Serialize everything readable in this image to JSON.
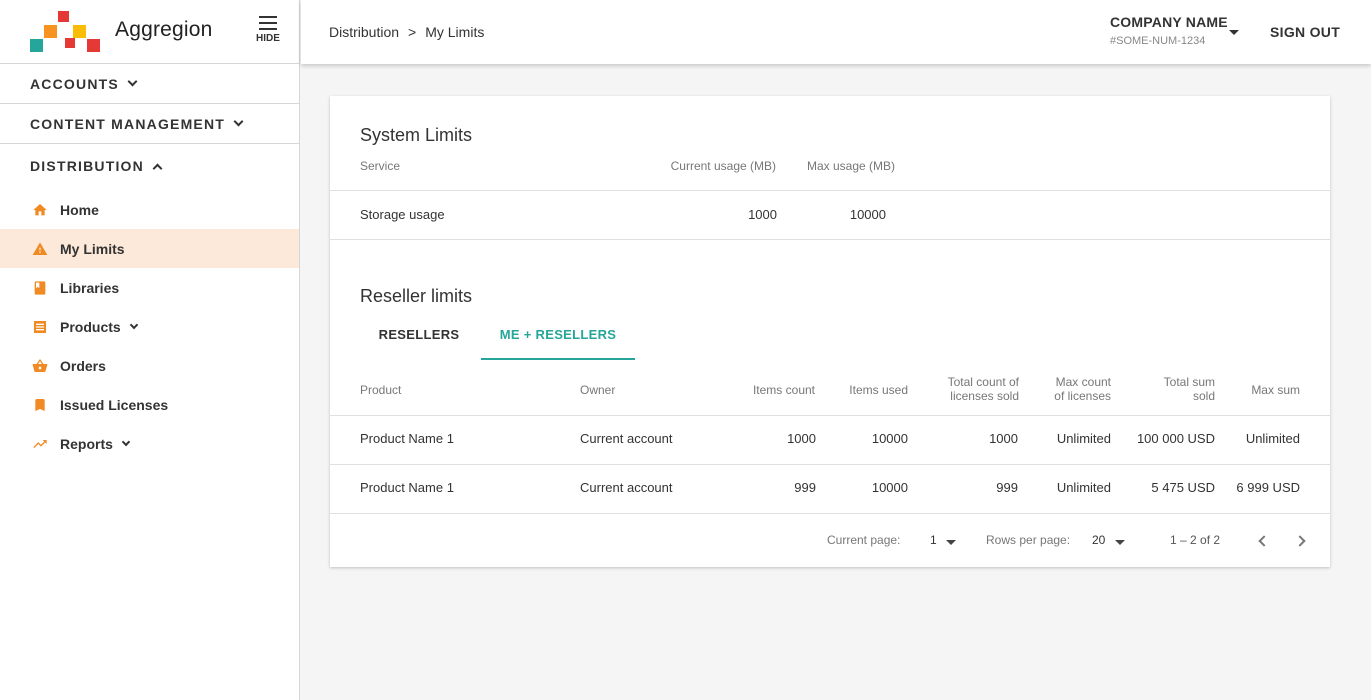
{
  "app": {
    "brand_name": "Aggregion",
    "hide_label": "HIDE"
  },
  "sidebar": {
    "sections": [
      {
        "label": "ACCOUNTS"
      },
      {
        "label": "CONTENT MANAGEMENT"
      },
      {
        "label": "DISTRIBUTION"
      }
    ],
    "items": [
      {
        "label": "Home",
        "icon": "home-icon"
      },
      {
        "label": "My Limits",
        "icon": "warning-icon"
      },
      {
        "label": "Libraries",
        "icon": "book-icon"
      },
      {
        "label": "Products",
        "icon": "list-icon"
      },
      {
        "label": "Orders",
        "icon": "basket-icon"
      },
      {
        "label": "Issued Licenses",
        "icon": "bookmark-icon"
      },
      {
        "label": "Reports",
        "icon": "trending-up-icon"
      }
    ],
    "accent_color": "#f08a24",
    "active_bg": "#fde9d9"
  },
  "header": {
    "breadcrumb": [
      "Distribution",
      "My Limits"
    ],
    "breadcrumb_sep": ">",
    "company_name": "COMPANY NAME",
    "company_number": "#SOME-NUM-1234",
    "sign_out": "SIGN OUT"
  },
  "system_limits": {
    "title": "System Limits",
    "columns": [
      "Service",
      "Current usage (MB)",
      "Max usage (MB)"
    ],
    "rows": [
      [
        "Storage usage",
        "1000",
        "10000"
      ]
    ]
  },
  "reseller_limits": {
    "title": "Reseller limits",
    "tabs": [
      "RESELLERS",
      "ME + RESELLERS"
    ],
    "active_tab": "ME + RESELLERS",
    "accent_color": "#26a69a",
    "columns": [
      [
        "Product"
      ],
      [
        "Owner"
      ],
      [
        "Items count"
      ],
      [
        "Items used"
      ],
      [
        "Total count of",
        "licenses sold"
      ],
      [
        "Max count",
        "of licenses"
      ],
      [
        "Total sum",
        "sold"
      ],
      [
        "Max sum"
      ]
    ],
    "rows": [
      [
        "Product Name 1",
        "Current account",
        "1000",
        "10000",
        "1000",
        "Unlimited",
        "100 000 USD",
        "Unlimited"
      ],
      [
        "Product Name 1",
        "Current account",
        "999",
        "10000",
        "999",
        "Unlimited",
        "5 475 USD",
        "6 999 USD"
      ]
    ]
  },
  "pagination": {
    "current_page_label": "Current page:",
    "current_page": "1",
    "rows_per_page_label": "Rows per page:",
    "rows_per_page": "20",
    "range": "1 – 2 of 2"
  }
}
